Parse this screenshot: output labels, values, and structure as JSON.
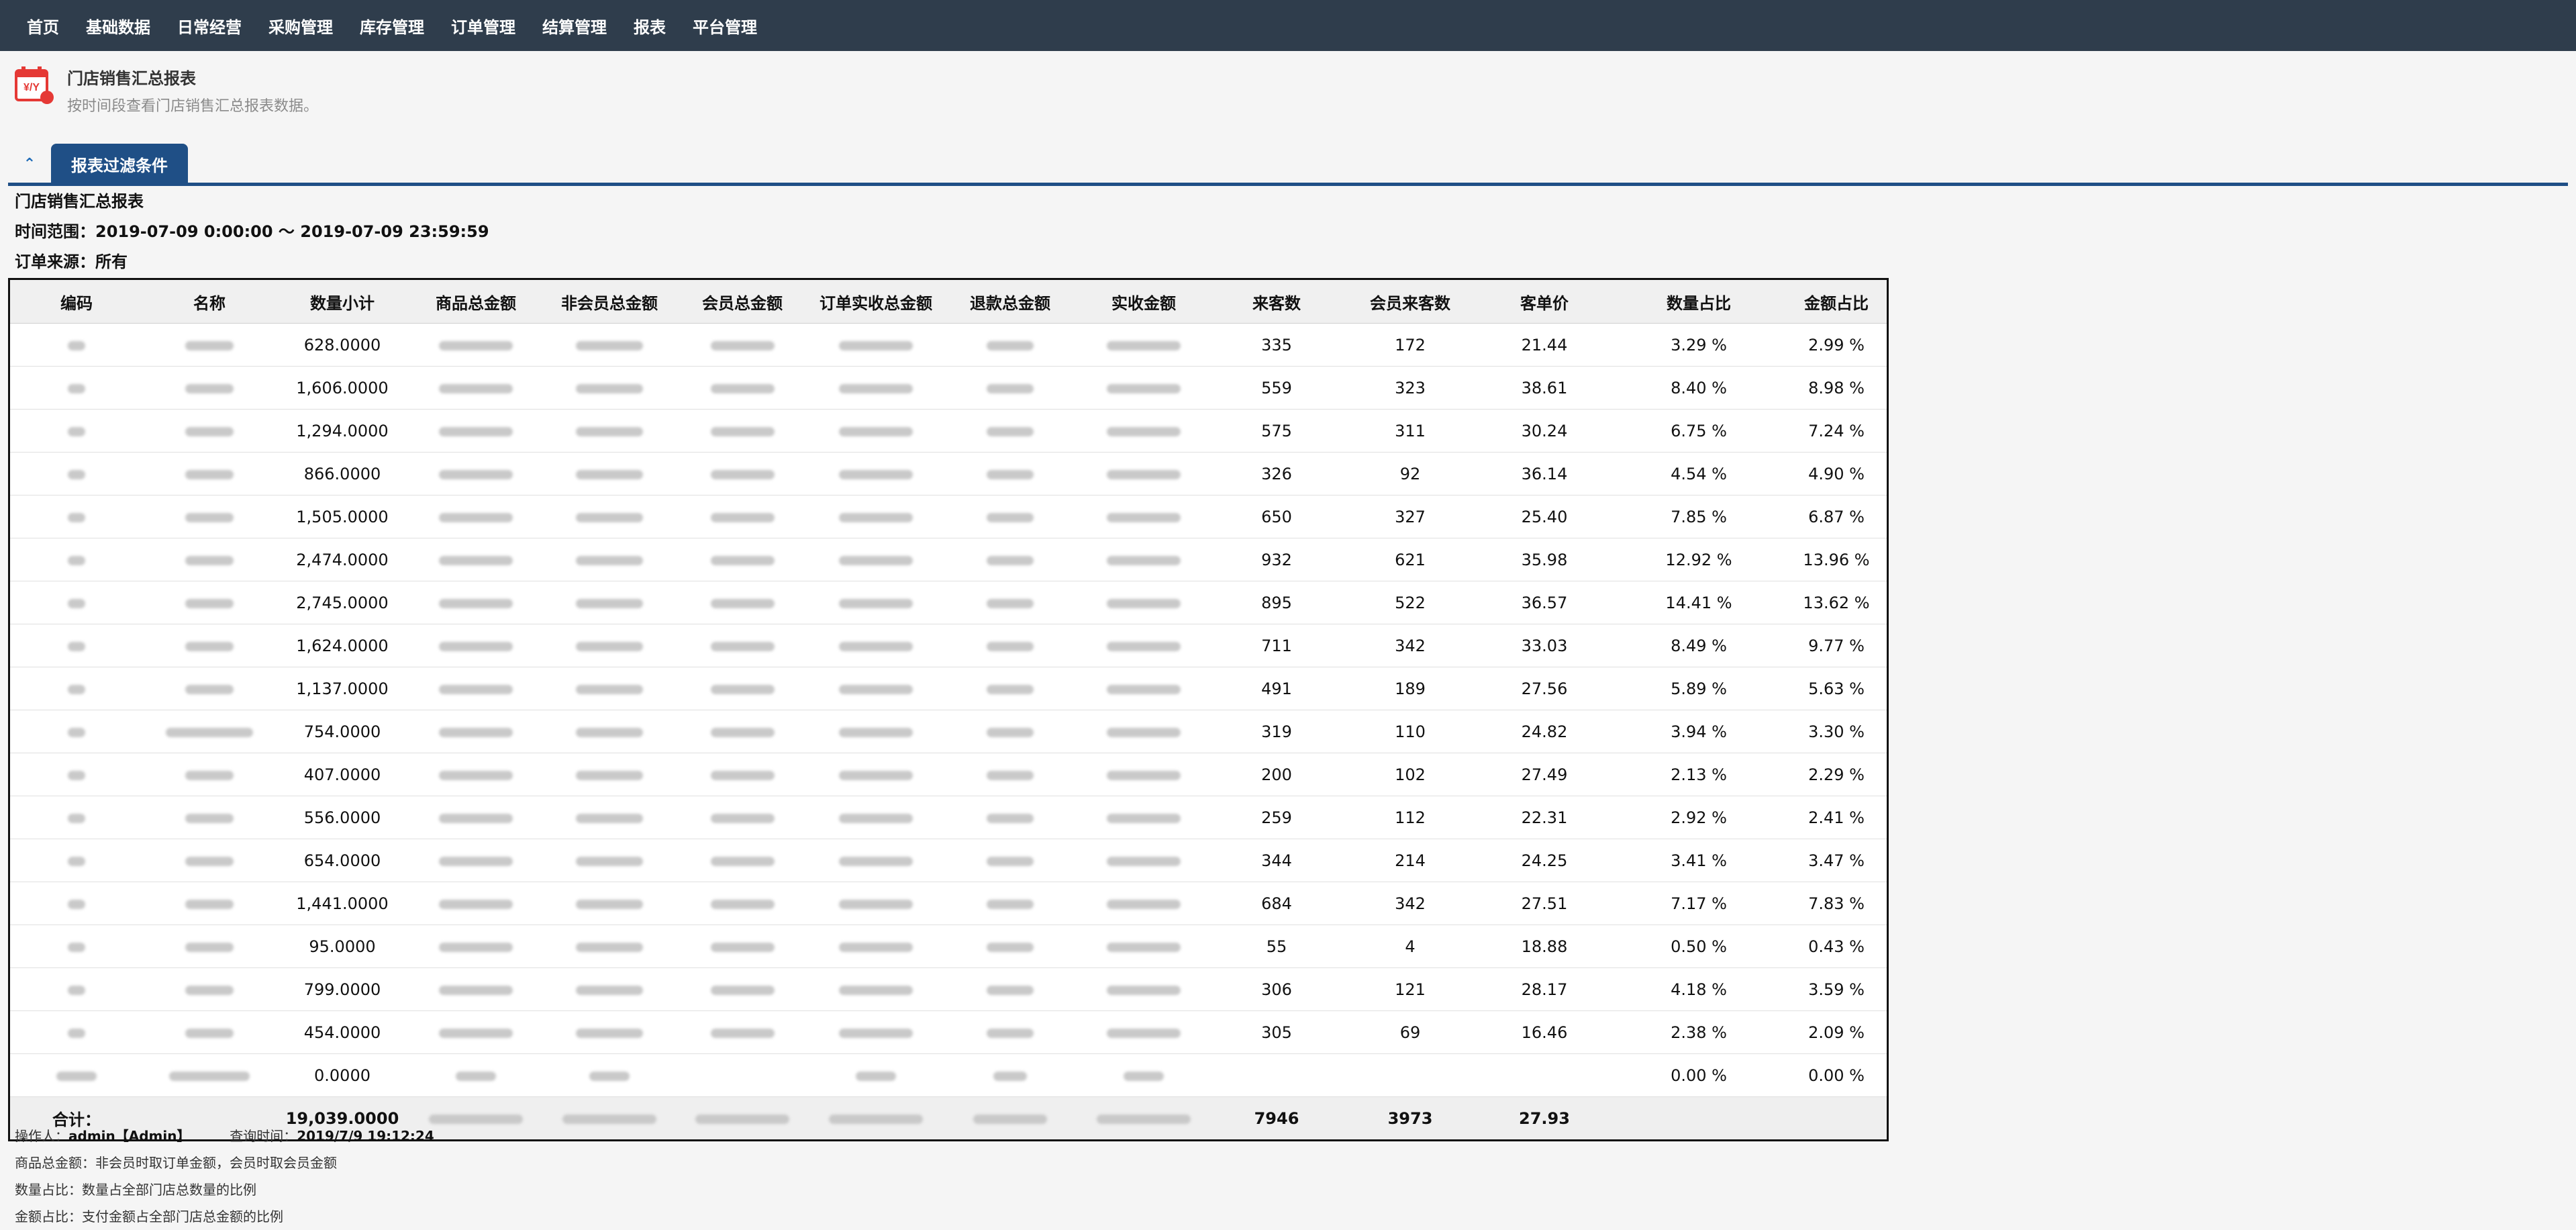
{
  "nav": {
    "items": [
      "首页",
      "基础数据",
      "日常经营",
      "采购管理",
      "库存管理",
      "订单管理",
      "结算管理",
      "报表",
      "平台管理"
    ]
  },
  "header": {
    "title": "门店销售汇总报表",
    "subtitle": "按时间段查看门店销售汇总报表数据。",
    "icon": "calendar-money-icon"
  },
  "tabs": {
    "active_label": "报表过滤条件"
  },
  "report": {
    "title": "门店销售汇总报表",
    "time_range": "时间范围：2019-07-09 0:00:00  ～  2019-07-09 23:59:59",
    "order_source": "订单来源：所有"
  },
  "table": {
    "headers": [
      "编码",
      "名称",
      "数量小计",
      "商品总金额",
      "非会员总金额",
      "会员总金额",
      "订单实收总金额",
      "退款总金额",
      "实收金额",
      "来客数",
      "会员来客数",
      "客单价",
      "数量占比",
      "金额占比"
    ],
    "rows": [
      {
        "qty": "628.0000",
        "visitors": "335",
        "member_visitors": "172",
        "avg": "21.44",
        "qty_ratio": "3.29 %",
        "amount_ratio": "2.99 %"
      },
      {
        "qty": "1,606.0000",
        "visitors": "559",
        "member_visitors": "323",
        "avg": "38.61",
        "qty_ratio": "8.40 %",
        "amount_ratio": "8.98 %"
      },
      {
        "qty": "1,294.0000",
        "visitors": "575",
        "member_visitors": "311",
        "avg": "30.24",
        "qty_ratio": "6.75 %",
        "amount_ratio": "7.24 %"
      },
      {
        "qty": "866.0000",
        "visitors": "326",
        "member_visitors": "92",
        "avg": "36.14",
        "qty_ratio": "4.54 %",
        "amount_ratio": "4.90 %"
      },
      {
        "qty": "1,505.0000",
        "visitors": "650",
        "member_visitors": "327",
        "avg": "25.40",
        "qty_ratio": "7.85 %",
        "amount_ratio": "6.87 %"
      },
      {
        "qty": "2,474.0000",
        "visitors": "932",
        "member_visitors": "621",
        "avg": "35.98",
        "qty_ratio": "12.92 %",
        "amount_ratio": "13.96 %"
      },
      {
        "qty": "2,745.0000",
        "visitors": "895",
        "member_visitors": "522",
        "avg": "36.57",
        "qty_ratio": "14.41 %",
        "amount_ratio": "13.62 %"
      },
      {
        "qty": "1,624.0000",
        "visitors": "711",
        "member_visitors": "342",
        "avg": "33.03",
        "qty_ratio": "8.49 %",
        "amount_ratio": "9.77 %"
      },
      {
        "qty": "1,137.0000",
        "visitors": "491",
        "member_visitors": "189",
        "avg": "27.56",
        "qty_ratio": "5.89 %",
        "amount_ratio": "5.63 %"
      },
      {
        "qty": "754.0000",
        "visitors": "319",
        "member_visitors": "110",
        "avg": "24.82",
        "qty_ratio": "3.94 %",
        "amount_ratio": "3.30 %"
      },
      {
        "qty": "407.0000",
        "visitors": "200",
        "member_visitors": "102",
        "avg": "27.49",
        "qty_ratio": "2.13 %",
        "amount_ratio": "2.29 %"
      },
      {
        "qty": "556.0000",
        "visitors": "259",
        "member_visitors": "112",
        "avg": "22.31",
        "qty_ratio": "2.92 %",
        "amount_ratio": "2.41 %"
      },
      {
        "qty": "654.0000",
        "visitors": "344",
        "member_visitors": "214",
        "avg": "24.25",
        "qty_ratio": "3.41 %",
        "amount_ratio": "3.47 %"
      },
      {
        "qty": "1,441.0000",
        "visitors": "684",
        "member_visitors": "342",
        "avg": "27.51",
        "qty_ratio": "7.17 %",
        "amount_ratio": "7.83 %"
      },
      {
        "qty": "95.0000",
        "visitors": "55",
        "member_visitors": "4",
        "avg": "18.88",
        "qty_ratio": "0.50 %",
        "amount_ratio": "0.43 %"
      },
      {
        "qty": "799.0000",
        "visitors": "306",
        "member_visitors": "121",
        "avg": "28.17",
        "qty_ratio": "4.18 %",
        "amount_ratio": "3.59 %"
      },
      {
        "qty": "454.0000",
        "visitors": "305",
        "member_visitors": "69",
        "avg": "16.46",
        "qty_ratio": "2.38 %",
        "amount_ratio": "2.09 %"
      },
      {
        "qty": "0.0000",
        "visitors": "",
        "member_visitors": "",
        "avg": "",
        "qty_ratio": "0.00 %",
        "amount_ratio": "0.00 %"
      }
    ],
    "summary": {
      "label": "合计：",
      "qty": "19,039.0000",
      "visitors": "7946",
      "member_visitors": "3973",
      "avg": "27.93"
    }
  },
  "footer": {
    "operator_label": "操作人：",
    "operator_value": "admin【Admin】",
    "query_time_label": "查询时间：",
    "query_time_value": "2019/7/9 19:12:24",
    "note1": "商品总金额：非会员时取订单金额，会员时取会员金额",
    "note2": "数量占比：数量占全部门店总数量的比例",
    "note3": "金额占比：支付金额占全部门店总金额的比例"
  },
  "colors": {
    "nav_bg": "#2f3d4c",
    "tab_active": "#1f4f86",
    "logo_red": "#e53935"
  }
}
